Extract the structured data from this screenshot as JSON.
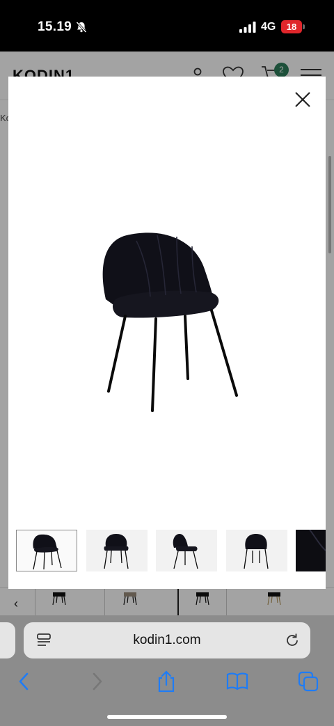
{
  "status_bar": {
    "time": "15.19",
    "network": "4G",
    "battery_level": "18"
  },
  "site": {
    "logo": "KODIN1",
    "cart_count": "2",
    "breadcrumb_fragment": "Ko"
  },
  "modal": {
    "image_alt": "Black velvet dining chair",
    "thumbnails": [
      {
        "view": "front-angle",
        "active": true
      },
      {
        "view": "front"
      },
      {
        "view": "side"
      },
      {
        "view": "back"
      },
      {
        "view": "detail"
      }
    ]
  },
  "browser": {
    "url": "kodin1.com"
  },
  "colors": {
    "cart_badge": "#2e7d5b",
    "battery": "#e0262b",
    "ios_blue": "#1f7cf5"
  },
  "icons": [
    "mute-bell-icon",
    "signal-icon",
    "battery-icon",
    "account-icon",
    "heart-icon",
    "cart-icon",
    "hamburger-icon",
    "close-icon",
    "reader-icon",
    "reload-icon",
    "back-icon",
    "forward-icon",
    "share-icon",
    "bookmarks-icon",
    "tabs-icon"
  ]
}
